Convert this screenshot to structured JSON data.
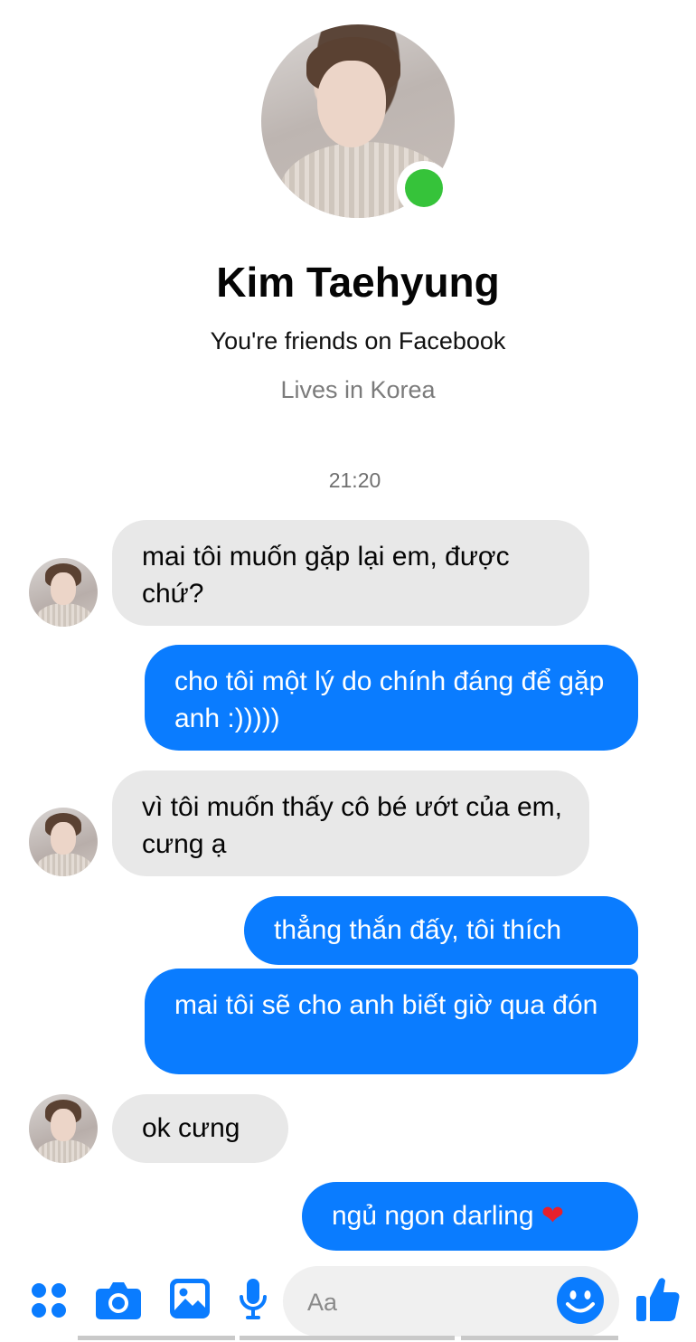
{
  "profile": {
    "name": "Kim Taehyung",
    "relationship": "You're friends on Facebook",
    "location": "Lives in Korea",
    "online_color": "#36c33a"
  },
  "conversation": {
    "timestamp": "21:20",
    "messages": [
      {
        "from": "them",
        "text": "mai tôi muốn gặp lại em, được chứ?"
      },
      {
        "from": "me",
        "text": "cho tôi một lý do chính đáng để gặp anh :)))))"
      },
      {
        "from": "them",
        "text": "vì tôi muốn thấy cô bé ướt của em, cưng ạ"
      },
      {
        "from": "me",
        "text": "thẳng thắn đấy, tôi thích"
      },
      {
        "from": "me",
        "text": "mai tôi sẽ cho anh biết giờ qua đón"
      },
      {
        "from": "them",
        "text": "ok cưng"
      },
      {
        "from": "me",
        "text": "ngủ ngon darling",
        "emoji": "heart"
      }
    ],
    "emoji_heart": "❤"
  },
  "composer": {
    "placeholder": "Aa",
    "icons": [
      "apps-icon",
      "camera-icon",
      "gallery-icon",
      "microphone-icon",
      "emoji-icon",
      "like-icon"
    ]
  },
  "colors": {
    "accent": "#0a7cff",
    "incoming_bubble": "#e8e8e8",
    "outgoing_bubble": "#0a7cff"
  }
}
